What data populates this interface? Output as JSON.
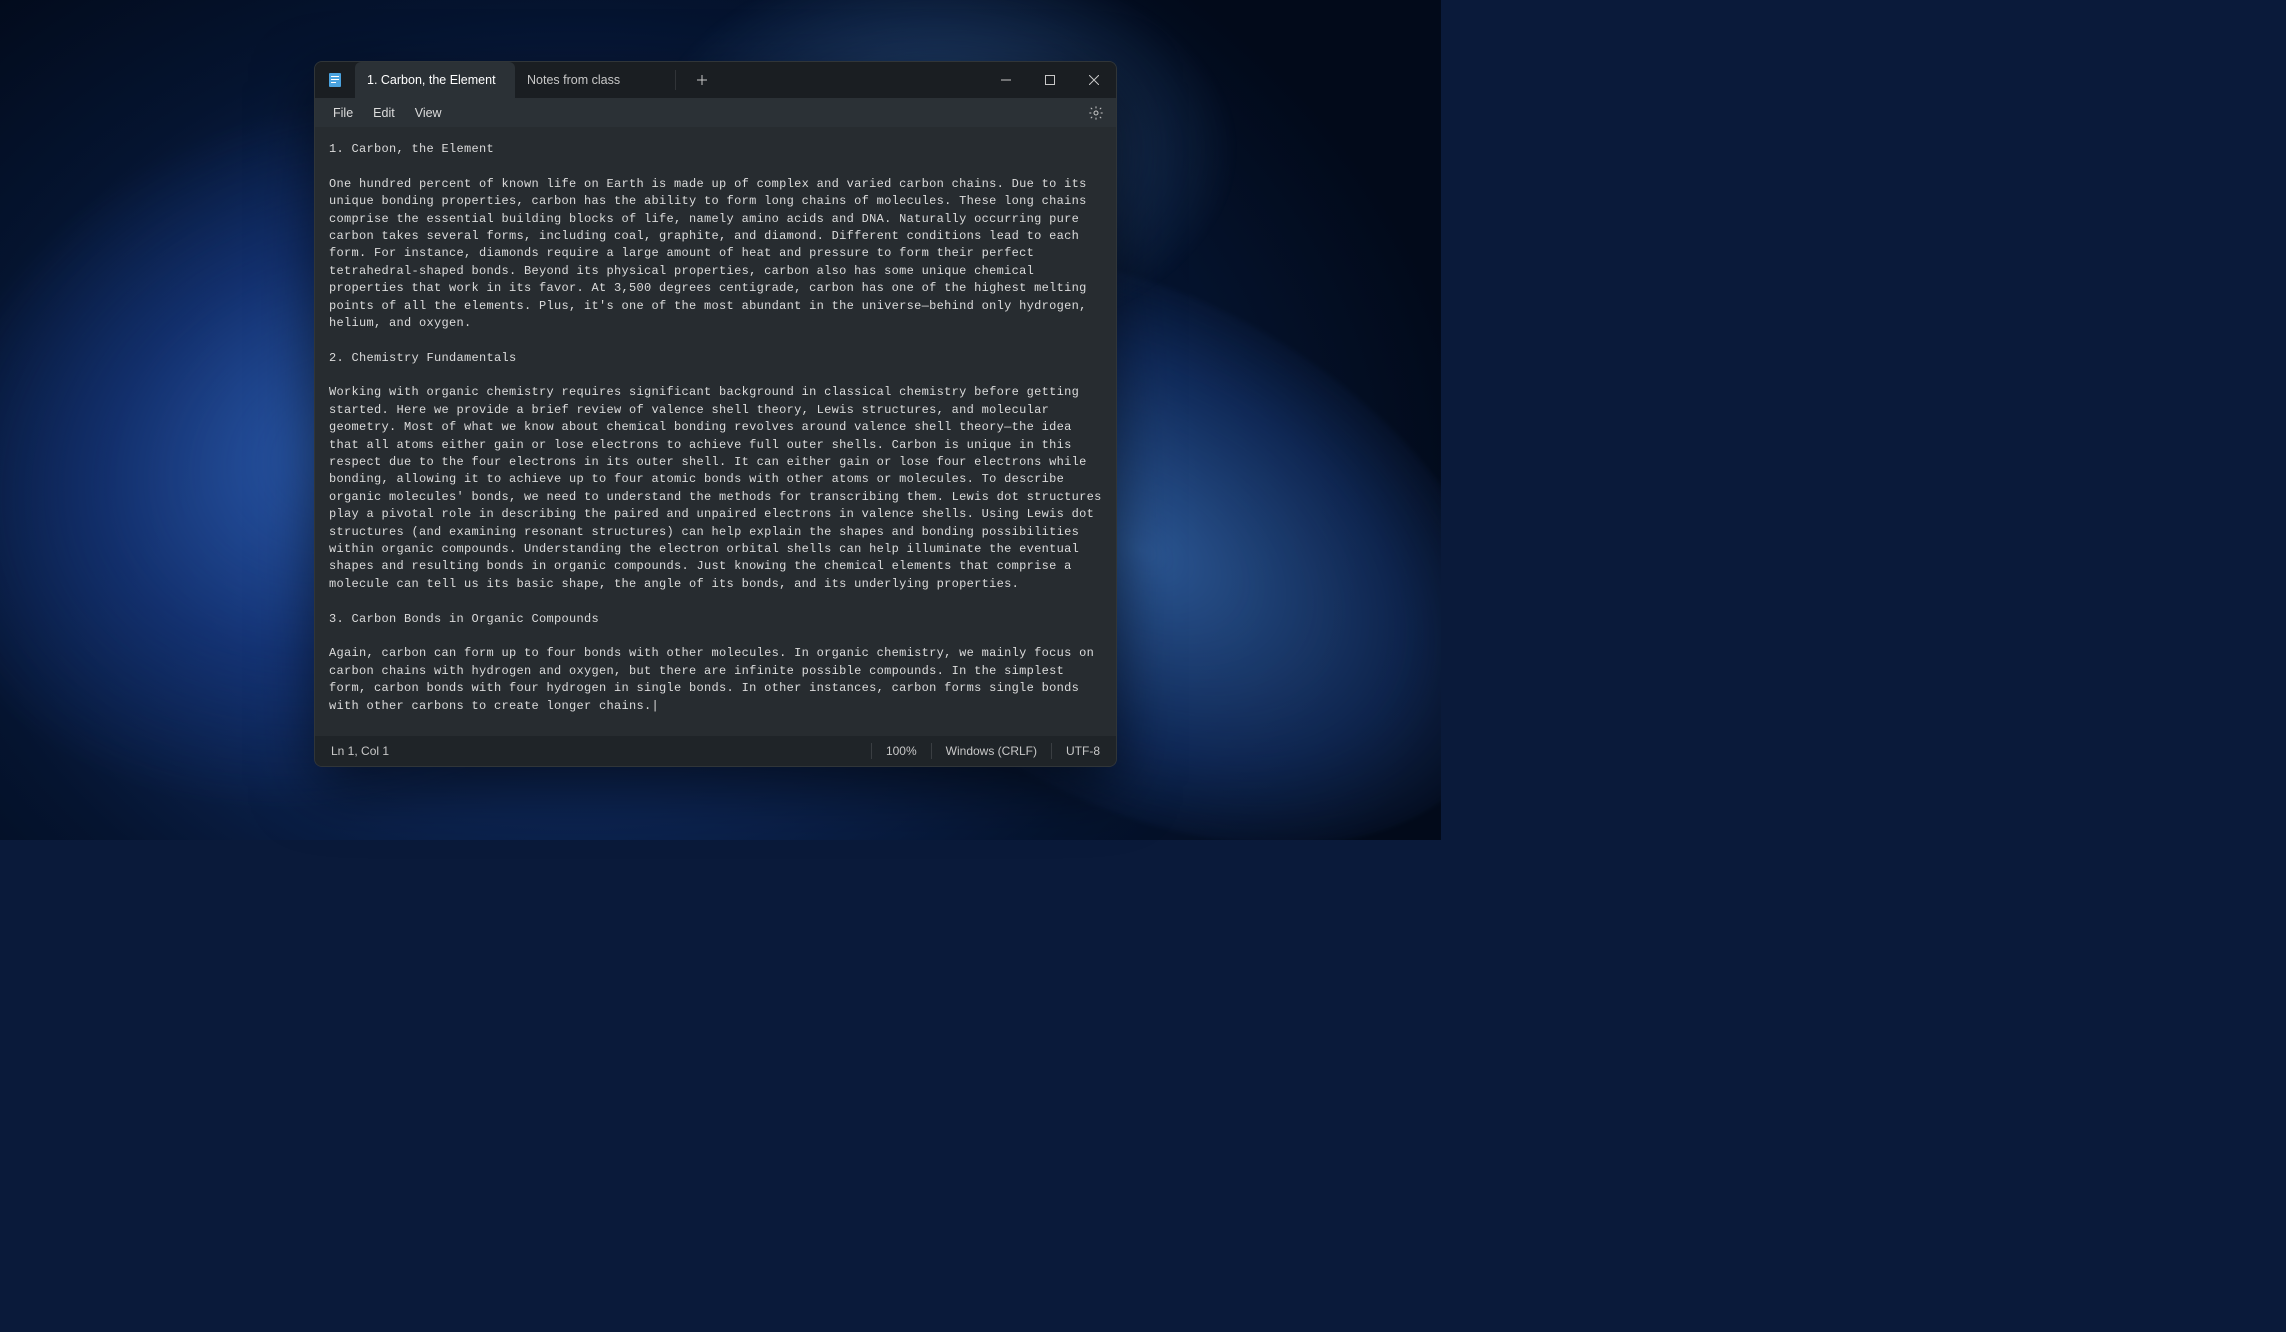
{
  "tabs": {
    "0": {
      "label": "1. Carbon, the Element"
    },
    "1": {
      "label": "Notes from class"
    }
  },
  "menu": {
    "file": "File",
    "edit": "Edit",
    "view": "View"
  },
  "document_text": "1. Carbon, the Element\n\nOne hundred percent of known life on Earth is made up of complex and varied carbon chains. Due to its unique bonding properties, carbon has the ability to form long chains of molecules. These long chains comprise the essential building blocks of life, namely amino acids and DNA. Naturally occurring pure carbon takes several forms, including coal, graphite, and diamond. Different conditions lead to each form. For instance, diamonds require a large amount of heat and pressure to form their perfect tetrahedral-shaped bonds. Beyond its physical properties, carbon also has some unique chemical properties that work in its favor. At 3,500 degrees centigrade, carbon has one of the highest melting points of all the elements. Plus, it's one of the most abundant in the universe—behind only hydrogen, helium, and oxygen.\n\n2. Chemistry Fundamentals\n\nWorking with organic chemistry requires significant background in classical chemistry before getting started. Here we provide a brief review of valence shell theory, Lewis structures, and molecular geometry. Most of what we know about chemical bonding revolves around valence shell theory—the idea that all atoms either gain or lose electrons to achieve full outer shells. Carbon is unique in this respect due to the four electrons in its outer shell. It can either gain or lose four electrons while bonding, allowing it to achieve up to four atomic bonds with other atoms or molecules. To describe organic molecules' bonds, we need to understand the methods for transcribing them. Lewis dot structures play a pivotal role in describing the paired and unpaired electrons in valence shells. Using Lewis dot structures (and examining resonant structures) can help explain the shapes and bonding possibilities within organic compounds. Understanding the electron orbital shells can help illuminate the eventual shapes and resulting bonds in organic compounds. Just knowing the chemical elements that comprise a molecule can tell us its basic shape, the angle of its bonds, and its underlying properties.\n\n3. Carbon Bonds in Organic Compounds\n\nAgain, carbon can form up to four bonds with other molecules. In organic chemistry, we mainly focus on carbon chains with hydrogen and oxygen, but there are infinite possible compounds. In the simplest form, carbon bonds with four hydrogen in single bonds. In other instances, carbon forms single bonds with other carbons to create longer chains.|",
  "statusbar": {
    "position": "Ln 1, Col 1",
    "zoom": "100%",
    "line_endings": "Windows (CRLF)",
    "encoding": "UTF-8"
  }
}
